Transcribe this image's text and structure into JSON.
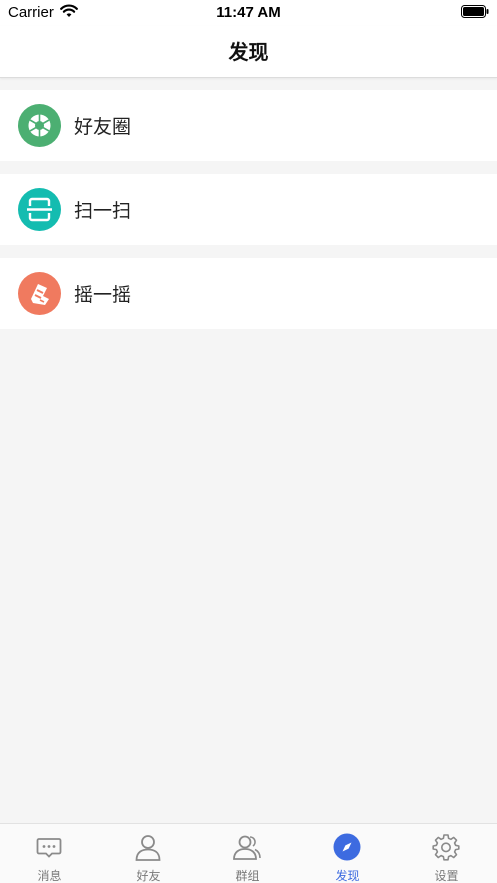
{
  "status_bar": {
    "carrier": "Carrier",
    "time": "11:47 AM"
  },
  "nav": {
    "title": "发现"
  },
  "items": [
    {
      "label": "好友圈",
      "icon": "aperture-icon",
      "color": "#4caf72"
    },
    {
      "label": "扫一扫",
      "icon": "scan-icon",
      "color": "#14bcb0"
    },
    {
      "label": "摇一摇",
      "icon": "shake-icon",
      "color": "#f07a5f"
    }
  ],
  "tabs": [
    {
      "label": "消息",
      "icon": "message-icon"
    },
    {
      "label": "好友",
      "icon": "person-icon"
    },
    {
      "label": "群组",
      "icon": "group-icon"
    },
    {
      "label": "发现",
      "icon": "compass-icon",
      "active": true
    },
    {
      "label": "设置",
      "icon": "gear-icon"
    }
  ],
  "colors": {
    "accent": "#3d6be0",
    "background": "#f5f5f5",
    "tab_inactive": "#7a7a7a"
  }
}
